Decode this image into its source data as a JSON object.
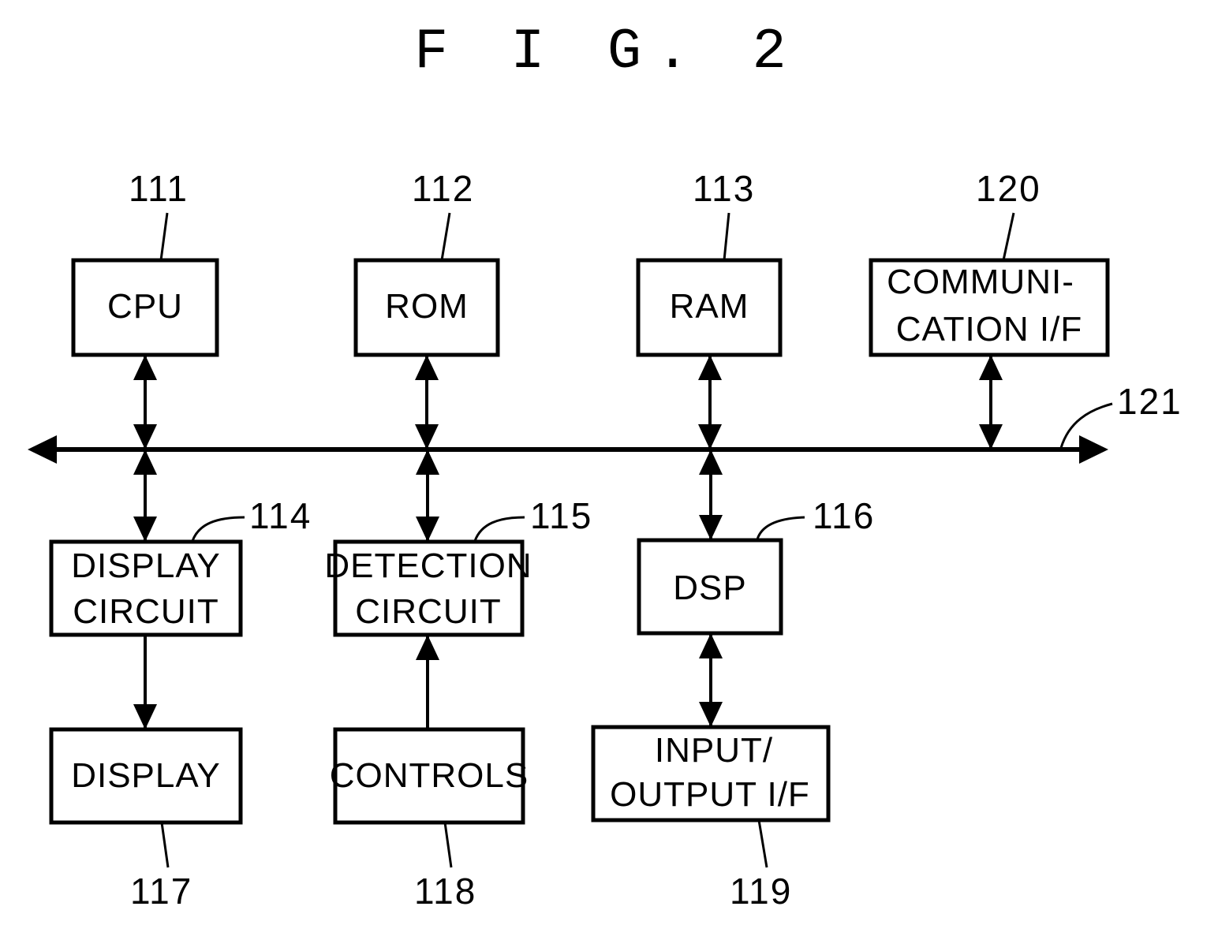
{
  "figure": {
    "title": "F I G. 2"
  },
  "blocks": {
    "cpu": {
      "ref": "111",
      "lines": [
        "CPU"
      ]
    },
    "rom": {
      "ref": "112",
      "lines": [
        "ROM"
      ]
    },
    "ram": {
      "ref": "113",
      "lines": [
        "RAM"
      ]
    },
    "comm": {
      "ref": "120",
      "lines": [
        "COMMUNI-",
        "CATION I/F"
      ]
    },
    "display_circuit": {
      "ref": "114",
      "lines": [
        "DISPLAY",
        "CIRCUIT"
      ]
    },
    "detection_circuit": {
      "ref": "115",
      "lines": [
        "DETECTION",
        "CIRCUIT"
      ]
    },
    "dsp": {
      "ref": "116",
      "lines": [
        "DSP"
      ]
    },
    "display": {
      "ref": "117",
      "lines": [
        "DISPLAY"
      ]
    },
    "controls": {
      "ref": "118",
      "lines": [
        "CONTROLS"
      ]
    },
    "io": {
      "ref": "119",
      "lines": [
        "INPUT/",
        "OUTPUT I/F"
      ]
    }
  },
  "bus": {
    "ref": "121"
  },
  "connections": [
    {
      "from": "cpu",
      "to": "bus",
      "direction": "bidirectional"
    },
    {
      "from": "rom",
      "to": "bus",
      "direction": "bidirectional"
    },
    {
      "from": "ram",
      "to": "bus",
      "direction": "bidirectional"
    },
    {
      "from": "comm",
      "to": "bus",
      "direction": "bidirectional"
    },
    {
      "from": "bus",
      "to": "display_circuit",
      "direction": "bidirectional"
    },
    {
      "from": "bus",
      "to": "detection_circuit",
      "direction": "bidirectional"
    },
    {
      "from": "bus",
      "to": "dsp",
      "direction": "bidirectional"
    },
    {
      "from": "display_circuit",
      "to": "display",
      "direction": "forward"
    },
    {
      "from": "controls",
      "to": "detection_circuit",
      "direction": "forward"
    },
    {
      "from": "dsp",
      "to": "io",
      "direction": "bidirectional"
    }
  ]
}
